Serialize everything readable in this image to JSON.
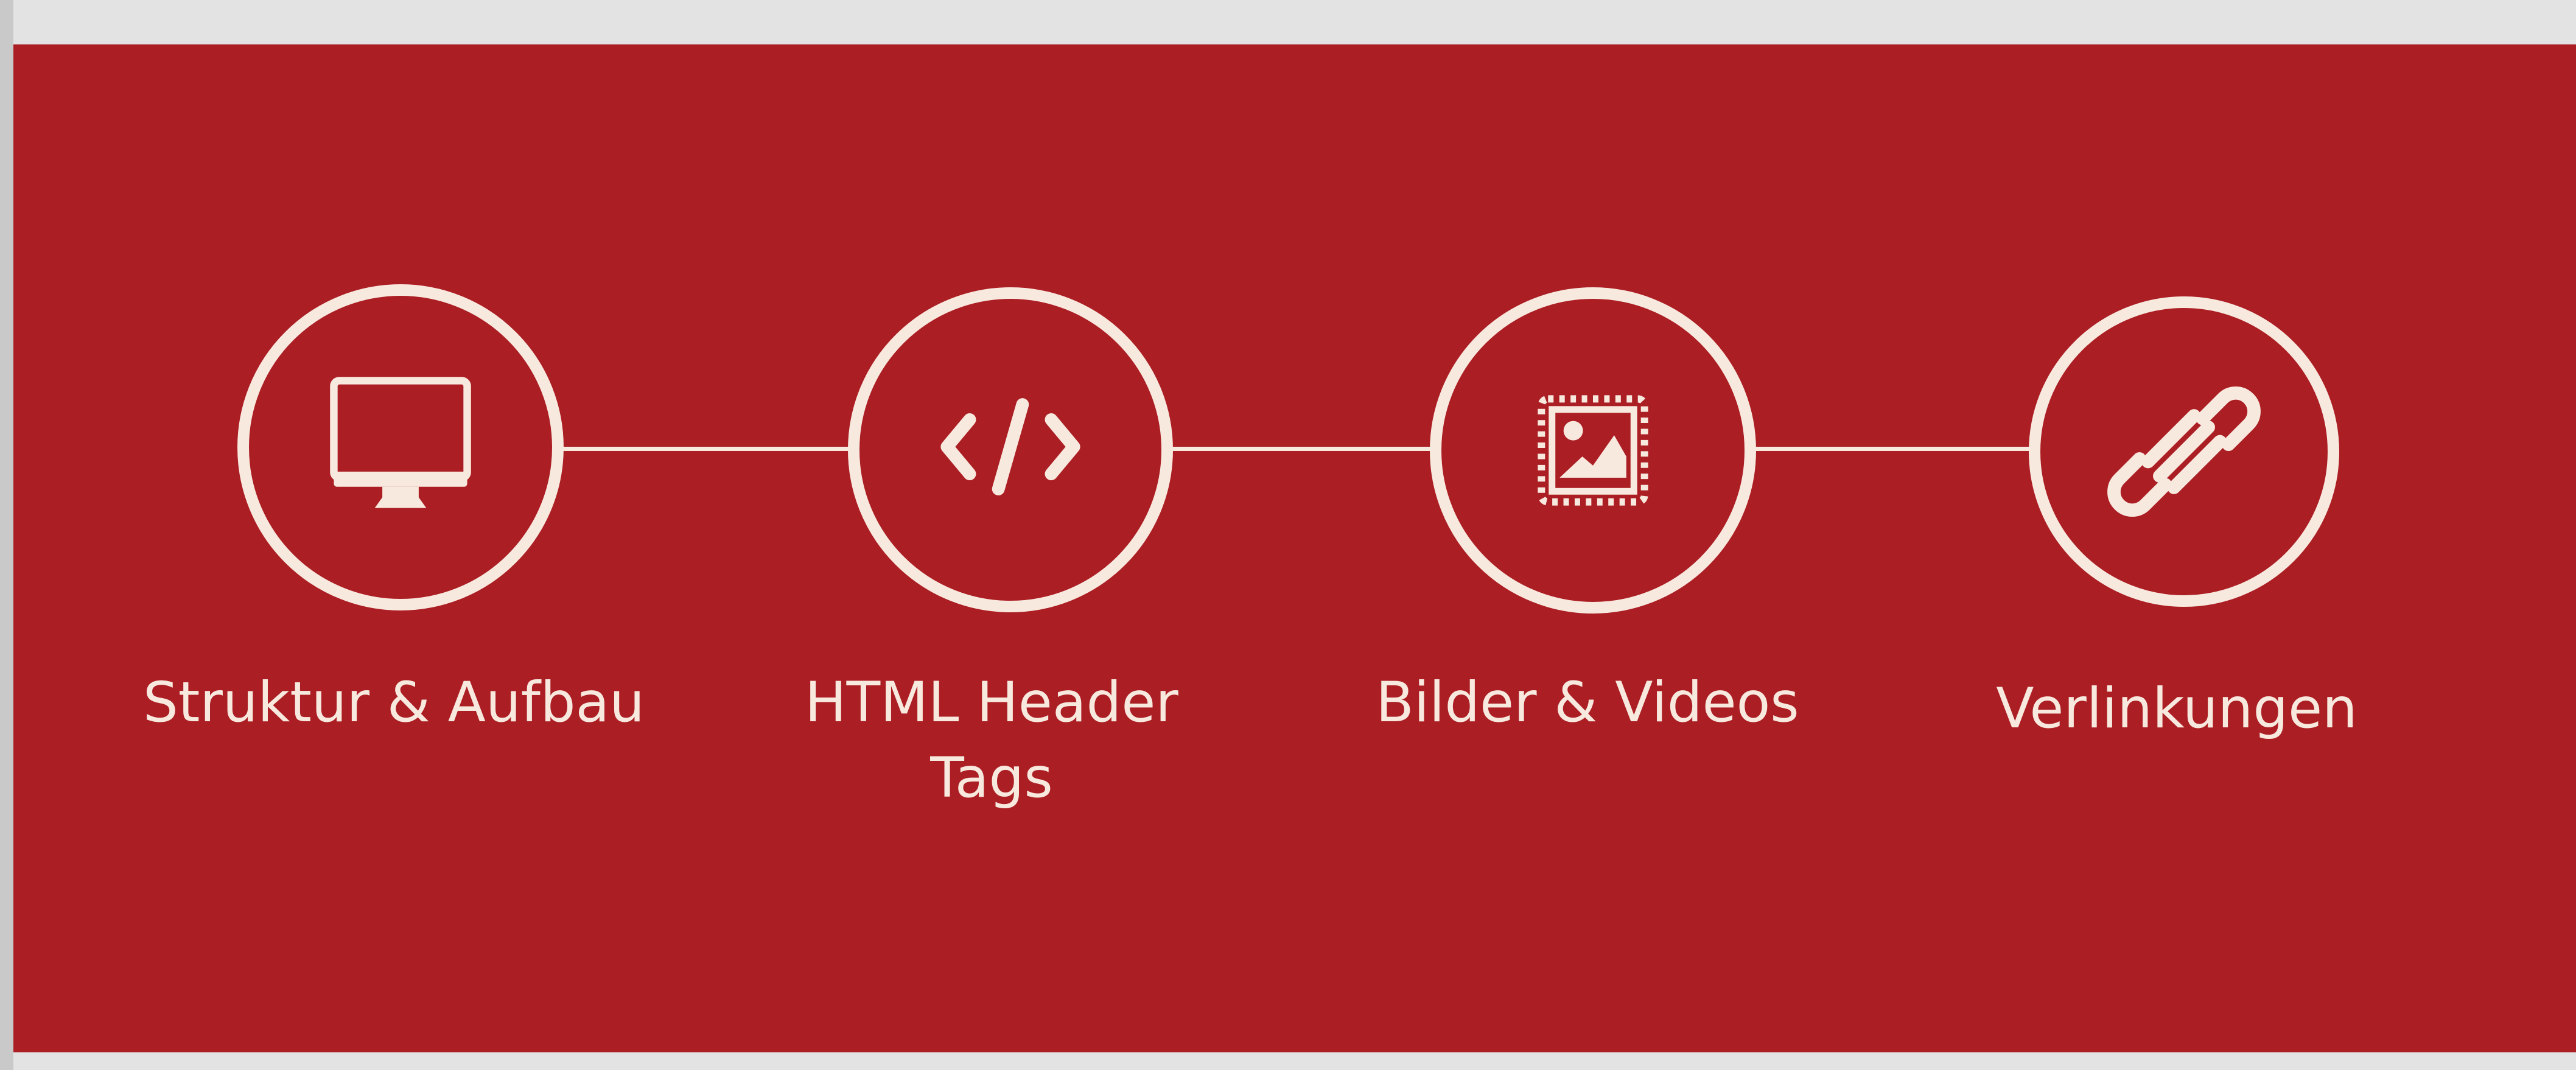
{
  "theme": {
    "background": "#ab1e24",
    "foreground": "#f8e9df",
    "page_background": "#e3e3e3"
  },
  "steps": [
    {
      "icon": "monitor-icon",
      "label": "Struktur & Aufbau"
    },
    {
      "icon": "code-icon",
      "label_line1": "HTML Header",
      "label_line2": "Tags"
    },
    {
      "icon": "image-icon",
      "label": "Bilder & Videos"
    },
    {
      "icon": "link-icon",
      "label": "Verlinkungen"
    }
  ]
}
